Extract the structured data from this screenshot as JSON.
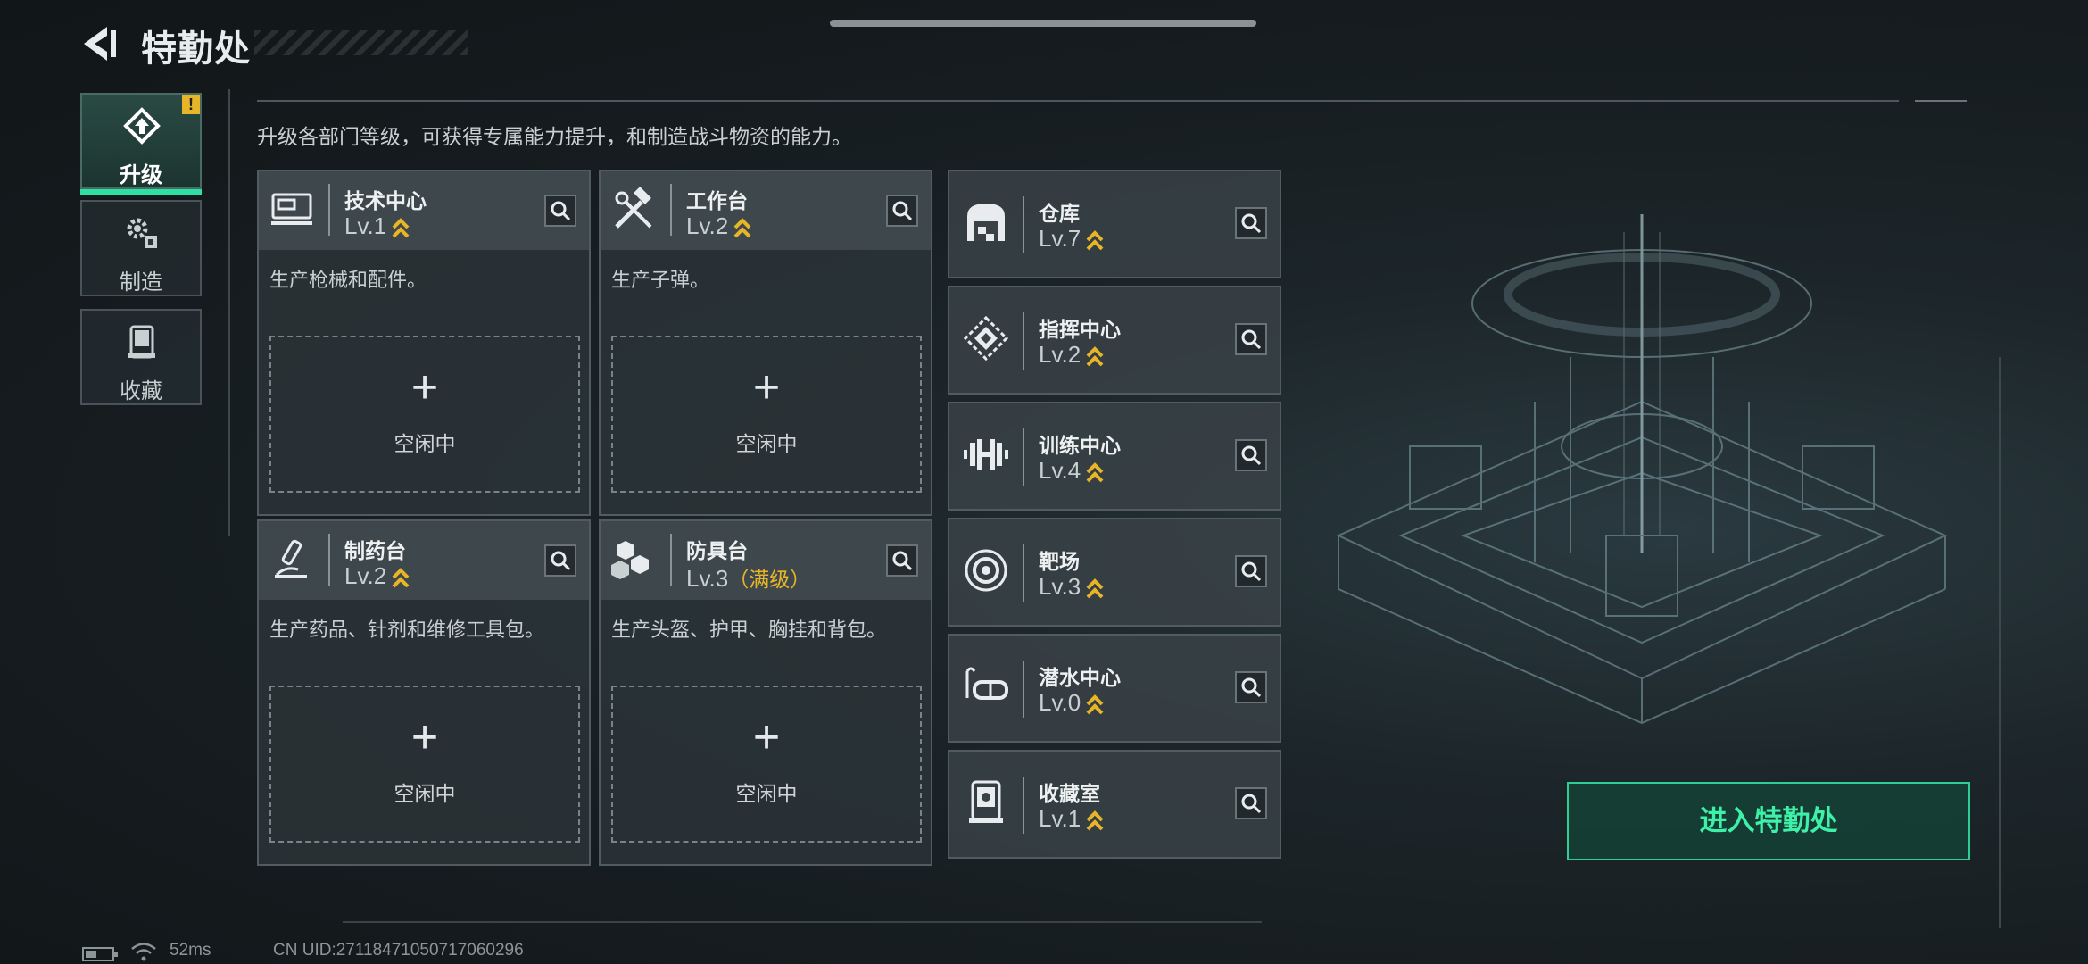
{
  "header": {
    "title": "特勤处"
  },
  "sidebar": {
    "items": [
      {
        "label": "升级",
        "badge": "!",
        "active": true,
        "icon": "upgrade-icon"
      },
      {
        "label": "制造",
        "active": false,
        "icon": "gear-craft-icon"
      },
      {
        "label": "收藏",
        "active": false,
        "icon": "collection-icon"
      }
    ]
  },
  "description": "升级各部门等级，可获得专属能力提升，和制造战斗物资的能力。",
  "workshops": [
    {
      "name": "技术中心",
      "level": "Lv.1",
      "desc": "生产枪械和配件。",
      "plus": "+",
      "slot": "空闲中",
      "icon": "tech-center-icon"
    },
    {
      "name": "工作台",
      "level": "Lv.2",
      "desc": "生产子弹。",
      "plus": "+",
      "slot": "空闲中",
      "icon": "workbench-icon"
    },
    {
      "name": "制药台",
      "level": "Lv.2",
      "desc": "生产药品、针剂和维修工具包。",
      "plus": "+",
      "slot": "空闲中",
      "icon": "pharmacy-icon"
    },
    {
      "name": "防具台",
      "level": "Lv.3",
      "max": "（满级）",
      "desc": "生产头盔、护甲、胸挂和背包。",
      "plus": "+",
      "slot": "空闲中",
      "icon": "armor-bench-icon"
    }
  ],
  "facilities": [
    {
      "name": "仓库",
      "level": "Lv.7",
      "icon": "warehouse-icon"
    },
    {
      "name": "指挥中心",
      "level": "Lv.2",
      "icon": "command-center-icon"
    },
    {
      "name": "训练中心",
      "level": "Lv.4",
      "icon": "training-center-icon"
    },
    {
      "name": "靶场",
      "level": "Lv.3",
      "icon": "shooting-range-icon"
    },
    {
      "name": "潜水中心",
      "level": "Lv.0",
      "icon": "diving-center-icon"
    },
    {
      "name": "收藏室",
      "level": "Lv.1",
      "icon": "collection-room-icon"
    }
  ],
  "enter_button": "进入特勤处",
  "status": {
    "ping": "52ms",
    "uid": "CN UID:27118471050717060296"
  },
  "colors": {
    "accent": "#2ee0a2",
    "gold": "#e8b528",
    "warn": "#e8b528"
  }
}
